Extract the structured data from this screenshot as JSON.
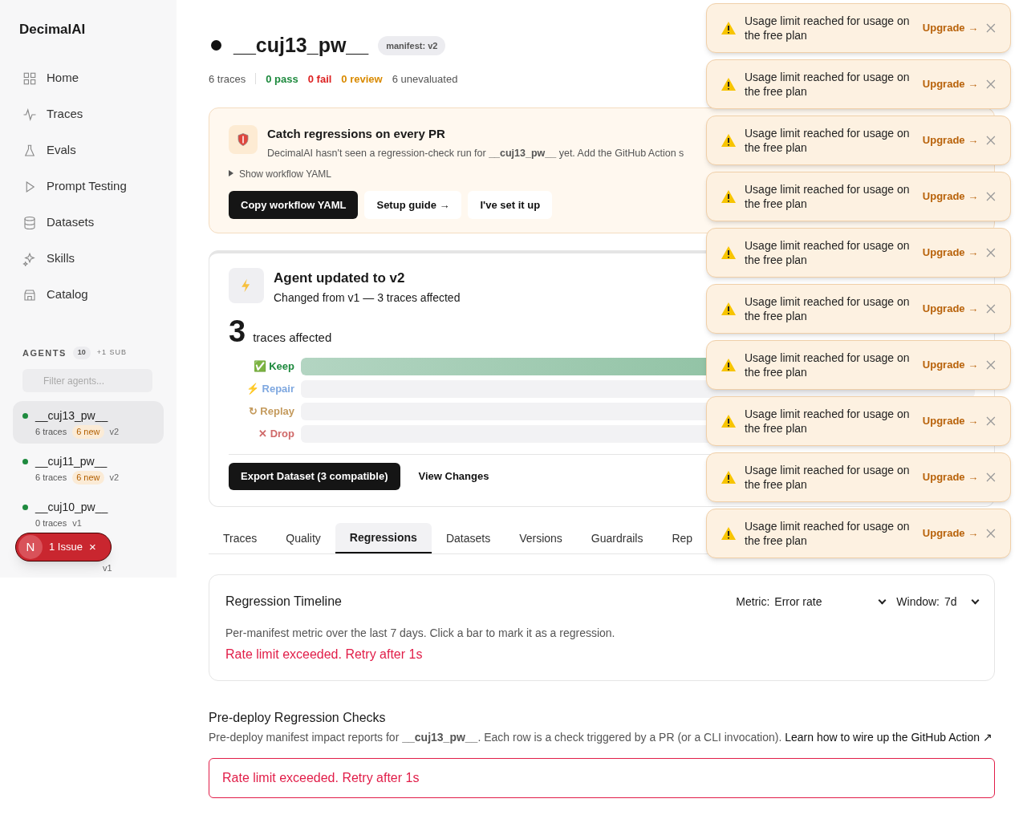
{
  "brand": "DecimalAI",
  "nav": [
    {
      "label": "Home"
    },
    {
      "label": "Traces"
    },
    {
      "label": "Evals"
    },
    {
      "label": "Prompt Testing"
    },
    {
      "label": "Datasets"
    },
    {
      "label": "Skills"
    },
    {
      "label": "Catalog"
    }
  ],
  "agents_header": {
    "label": "AGENTS",
    "count": "10",
    "sub": "+1 SUB"
  },
  "filter": {
    "placeholder": "Filter agents..."
  },
  "agents": [
    {
      "name": "__cuj13_pw__",
      "traces": "6 traces",
      "new": "6 new",
      "version": "v2",
      "selected": true
    },
    {
      "name": "__cuj11_pw__",
      "traces": "6 traces",
      "new": "6 new",
      "version": "v2",
      "selected": false
    },
    {
      "name": "__cuj10_pw__",
      "traces": "0 traces",
      "version": "v1",
      "selected": false
    },
    {
      "version": "v1",
      "selected": false
    }
  ],
  "issue_badge": {
    "letter": "N",
    "label": "1 Issue",
    "close": "×"
  },
  "header": {
    "title": "__cuj13_pw__",
    "manifest": "manifest: v2",
    "stats": [
      {
        "text": "6 traces",
        "kind": "total"
      },
      {
        "text": "0 pass",
        "kind": "pass"
      },
      {
        "text": "0 fail",
        "kind": "fail"
      },
      {
        "text": "0 review",
        "kind": "review"
      },
      {
        "text": "6 unevaluated",
        "kind": "other"
      }
    ]
  },
  "ci_card": {
    "title": "Catch regressions on every PR",
    "description": "DecimalAI hasn't seen a regression-check run for **__cuj13_pw__** yet. Add the GitHub Action s",
    "toggle": "Show workflow YAML",
    "buttons": [
      {
        "label": "Copy workflow YAML",
        "kind": "primary"
      },
      {
        "label": "Setup guide →",
        "kind": "secondary"
      },
      {
        "label": "I've set it up",
        "kind": "secondary"
      }
    ]
  },
  "update_card": {
    "title": "Agent updated to v2",
    "subtitle": "Changed from v1 — 3 traces affected",
    "count": "3",
    "count_label": "traces affected",
    "bars": [
      {
        "icon": "✅",
        "label": "Keep",
        "kind": "keep",
        "level": 1
      },
      {
        "icon": "⚡",
        "label": "Repair",
        "kind": "repair",
        "level": 0
      },
      {
        "icon": "↻",
        "label": "Replay",
        "kind": "replay",
        "level": 0
      },
      {
        "icon": "✕",
        "label": "Drop",
        "kind": "drop",
        "level": 0
      }
    ],
    "buttons": [
      {
        "label": "Export Dataset (3 compatible)",
        "kind": "primary"
      },
      {
        "label": "View Changes",
        "kind": "secondary"
      }
    ]
  },
  "tabs": [
    {
      "label": "Traces",
      "selected": false
    },
    {
      "label": "Quality",
      "selected": false
    },
    {
      "label": "Regressions",
      "selected": true
    },
    {
      "label": "Datasets",
      "selected": false
    },
    {
      "label": "Versions",
      "selected": false
    },
    {
      "label": "Guardrails",
      "selected": false
    },
    {
      "label": "Rep",
      "selected": false
    }
  ],
  "timeline": {
    "title": "Regression Timeline",
    "metric_label": "Metric:",
    "metric": "Error rate",
    "window_label": "Window:",
    "window": "7d",
    "description": "Per-manifest metric over the last 7 days. Click a bar to mark it as a regression.",
    "error": "Rate limit exceeded. Retry after 1s"
  },
  "predeploy": {
    "title": "Pre-deploy Regression Checks",
    "description": "Pre-deploy manifest impact reports for **__cuj13_pw__**. Each row is a check triggered by a PR (or a CLI invocation).",
    "link": "Learn how to wire up the GitHub Action ↗",
    "error": "Rate limit exceeded. Retry after 1s"
  },
  "toasts": [
    {
      "message": "Usage limit reached for usage on the free plan",
      "action": "Upgrade →"
    },
    {
      "message": "Usage limit reached for usage on the free plan",
      "action": "Upgrade →"
    },
    {
      "message": "Usage limit reached for usage on the free plan",
      "action": "Upgrade →"
    },
    {
      "message": "Usage limit reached for usage on the free plan",
      "action": "Upgrade →"
    },
    {
      "message": "Usage limit reached for usage on the free plan",
      "action": "Upgrade →"
    },
    {
      "message": "Usage limit reached for usage on the free plan",
      "action": "Upgrade →"
    },
    {
      "message": "Usage limit reached for usage on the free plan",
      "action": "Upgrade →"
    },
    {
      "message": "Usage limit reached for usage on the free plan",
      "action": "Upgrade →"
    },
    {
      "message": "Usage limit reached for usage on the free plan",
      "action": "Upgrade →"
    },
    {
      "message": "Usage limit reached for usage on the free plan",
      "action": "Upgrade →"
    }
  ]
}
